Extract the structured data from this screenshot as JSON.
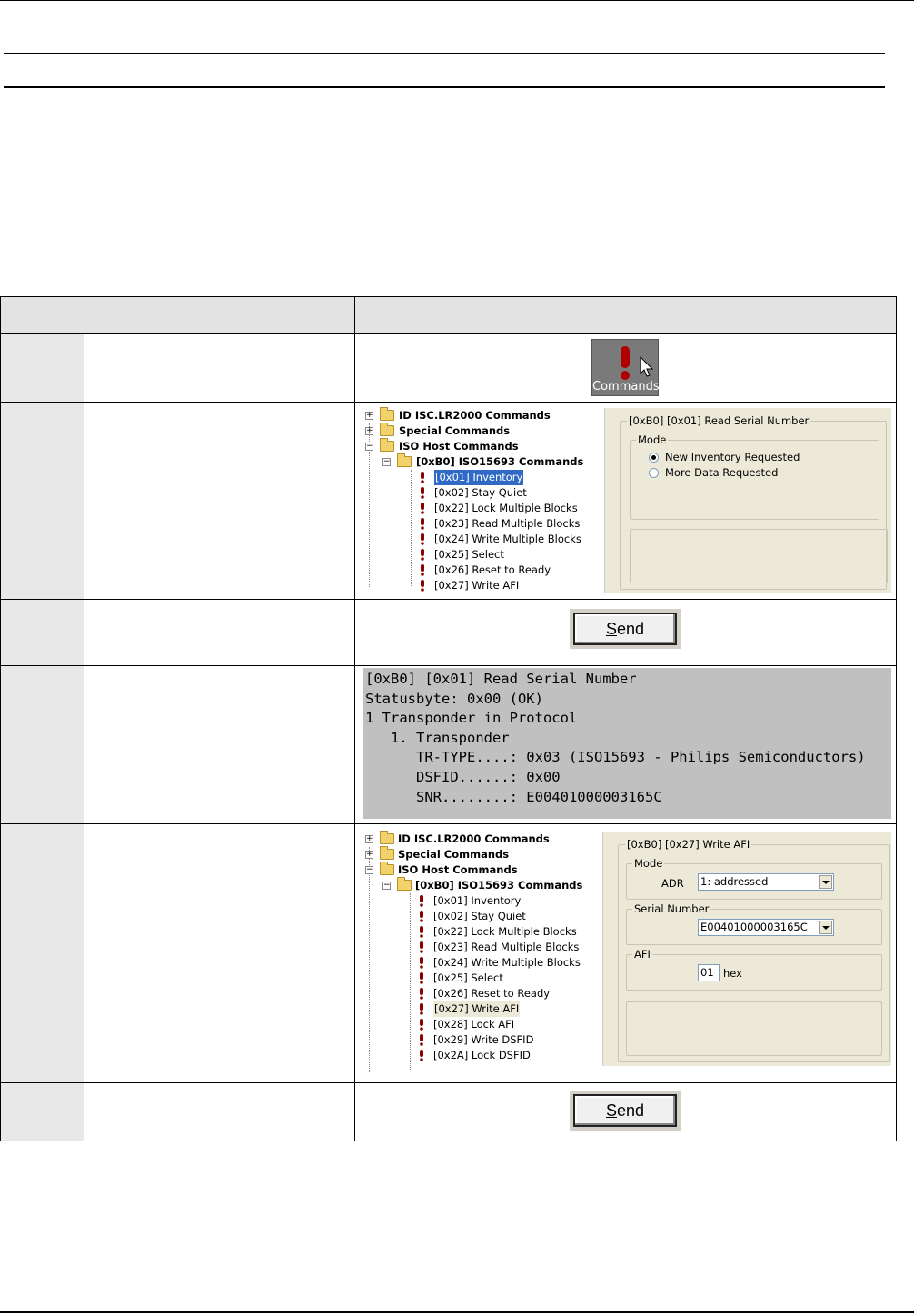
{
  "command_button": {
    "label": "Commands",
    "icon": "exclamation-icon"
  },
  "tree1": {
    "roots": [
      "ID ISC.LR2000 Commands",
      "Special Commands",
      "ISO Host Commands"
    ],
    "group": "[0xB0] ISO15693 Commands",
    "items": [
      "[0x01] Inventory",
      "[0x02] Stay Quiet",
      "[0x22] Lock Multiple Blocks",
      "[0x23] Read Multiple Blocks",
      "[0x24] Write Multiple Blocks",
      "[0x25] Select",
      "[0x26] Reset to Ready",
      "[0x27] Write AFI"
    ],
    "selected_index": 0
  },
  "panel1": {
    "title": "[0xB0] [0x01] Read Serial Number",
    "mode_legend": "Mode",
    "options": [
      "New Inventory Requested",
      "More Data Requested"
    ],
    "selected_option": 0
  },
  "send_label_prefix": "",
  "send_label_underlined": "S",
  "send_label_rest": "end",
  "console": {
    "lines": [
      "[0xB0] [0x01] Read Serial Number",
      "Statusbyte: 0x00 (OK)",
      "1 Transponder in Protocol",
      "   1. Transponder",
      "      TR-TYPE....: 0x03 (ISO15693 - Philips Semiconductors)",
      "      DSFID......: 0x00",
      "      SNR........: E00401000003165C"
    ]
  },
  "tree2": {
    "roots": [
      "ID ISC.LR2000 Commands",
      "Special Commands",
      "ISO Host Commands"
    ],
    "group": "[0xB0] ISO15693 Commands",
    "items": [
      "[0x01] Inventory",
      "[0x02] Stay Quiet",
      "[0x22] Lock Multiple Blocks",
      "[0x23] Read Multiple Blocks",
      "[0x24] Write Multiple Blocks",
      "[0x25] Select",
      "[0x26] Reset to Ready",
      "[0x27] Write AFI",
      "[0x28] Lock AFI",
      "[0x29] Write DSFID",
      "[0x2A] Lock DSFID"
    ],
    "selected_index": 7
  },
  "panel2": {
    "title": "[0xB0] [0x27] Write AFI",
    "mode_legend": "Mode",
    "adr_label": "ADR",
    "adr_value": "1: addressed",
    "serial_legend": "Serial Number",
    "serial_value": "E00401000003165C",
    "afi_legend": "AFI",
    "afi_value": "01",
    "afi_unit": "hex"
  }
}
